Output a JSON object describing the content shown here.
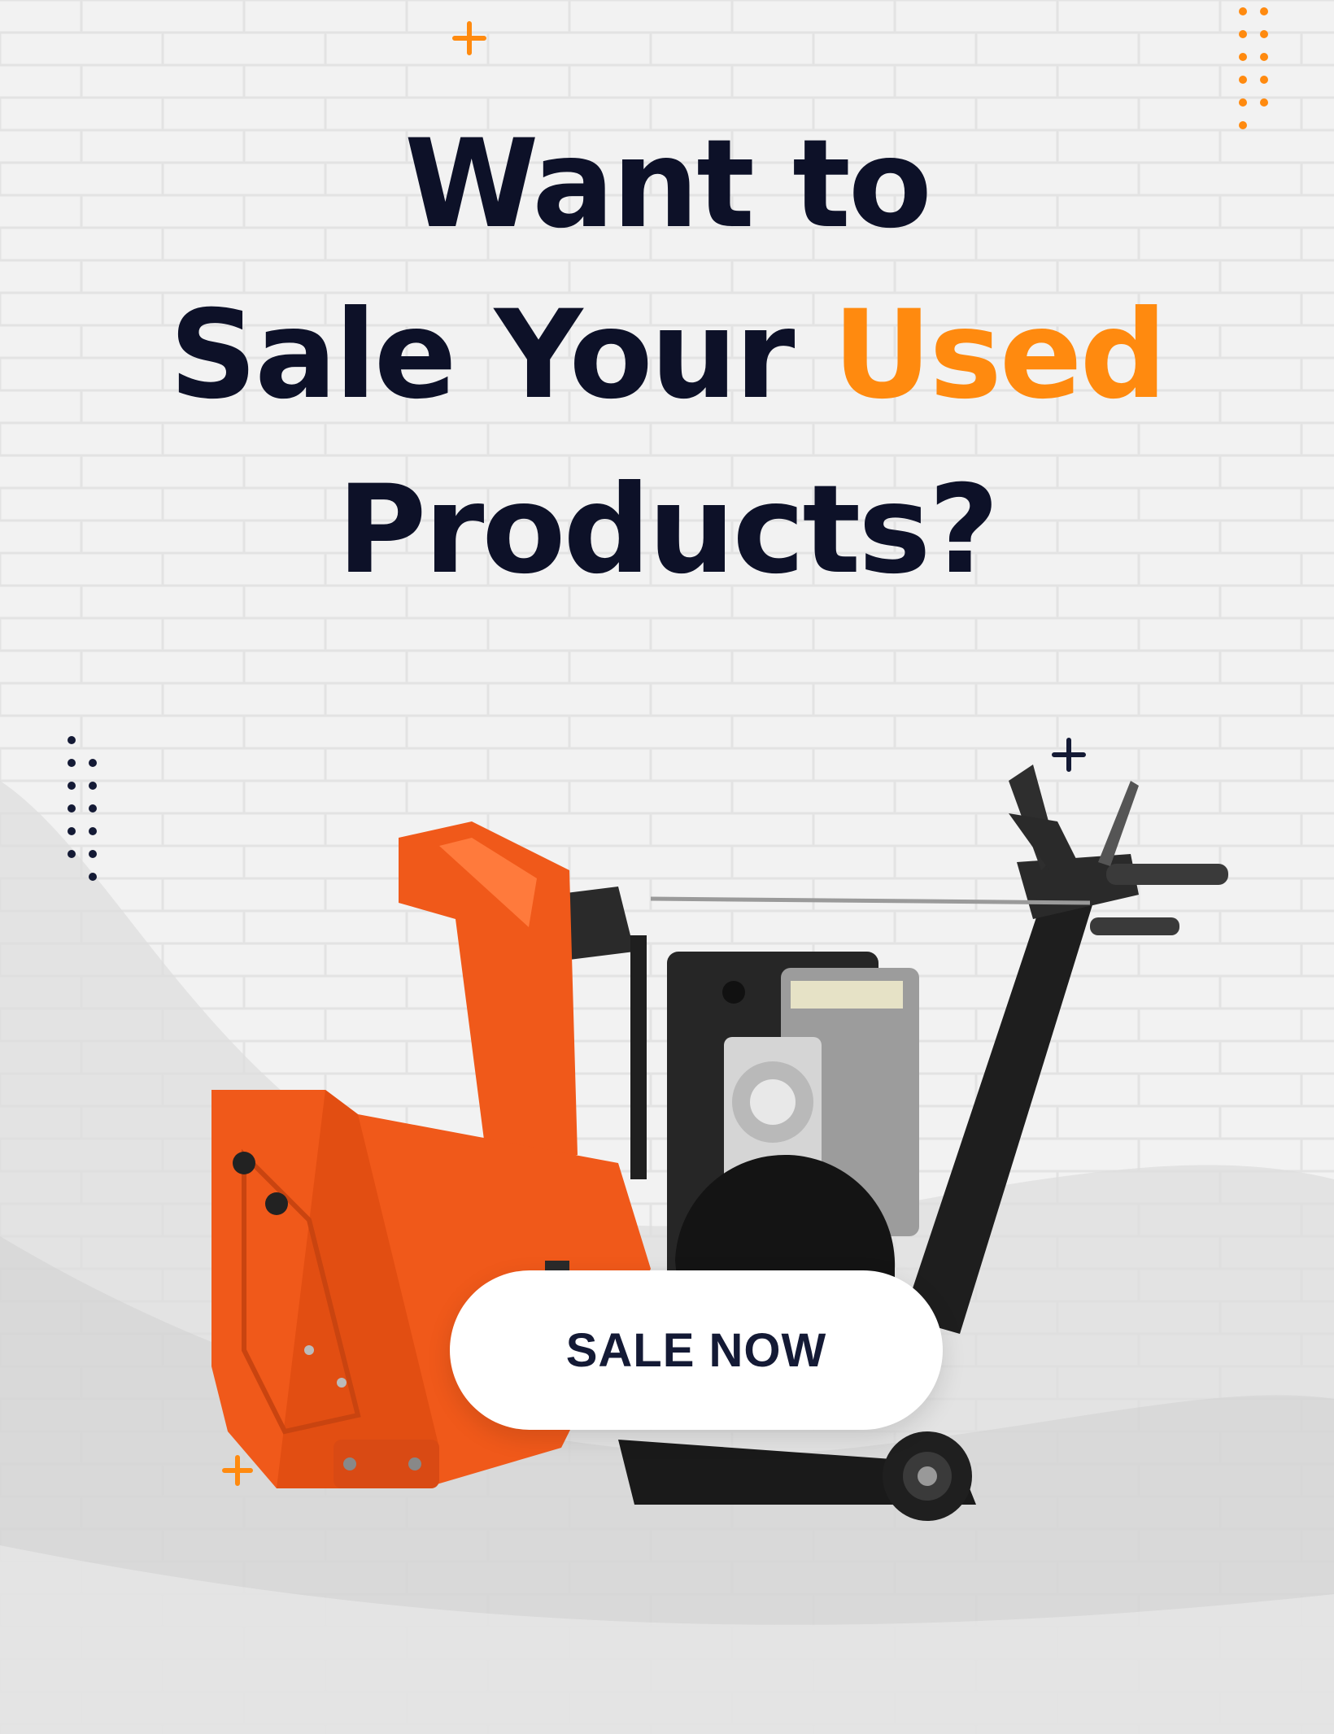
{
  "headline": {
    "line1": "Want to",
    "line2_prefix": "Sale Your ",
    "line2_accent": "Used",
    "line3": "Products?"
  },
  "cta": {
    "label": "SALE NOW"
  },
  "colors": {
    "accent": "#ff8a0f",
    "text": "#0d1128",
    "product": "#f0591a"
  },
  "icons": [
    "plus-icon",
    "dot-grid-icon",
    "snow-blower-image"
  ]
}
